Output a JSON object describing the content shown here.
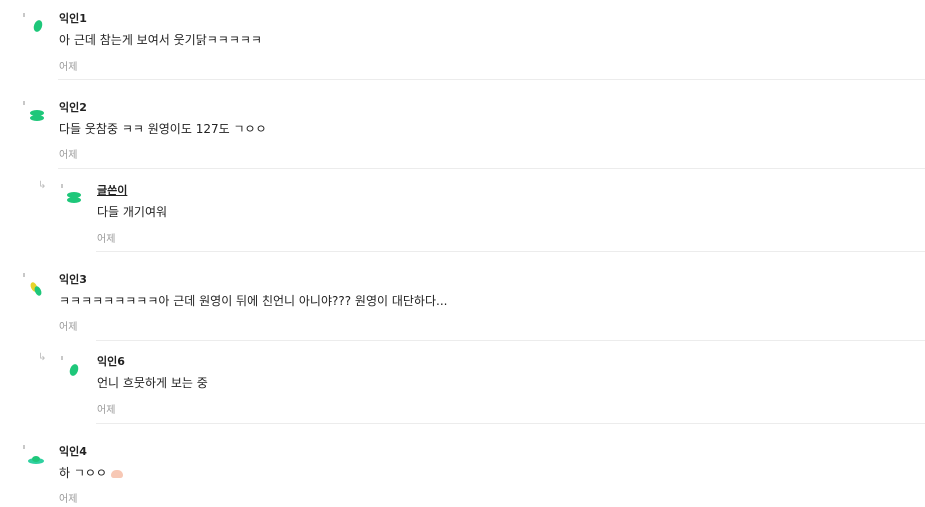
{
  "comments": [
    {
      "author": "익인1",
      "text": "아 근데 참는게 보여서 웃기닭ㅋㅋㅋㅋㅋ",
      "time": "어제"
    },
    {
      "author": "익인2",
      "text": "다들 웃참중 ㅋㅋ 원영이도 127도 ㄱㅇㅇ",
      "time": "어제"
    },
    {
      "author": "글쓴이",
      "text": "다들 개기여워",
      "time": "어제",
      "reply": true
    },
    {
      "author": "익인3",
      "text": "ㅋㅋㅋㅋㅋㅋㅋㅋㅋ아 근데 원영이 뒤에 친언니 아니야??? 원영이 대단하다...",
      "time": "어제"
    },
    {
      "author": "익인6",
      "text": "언니 흐뭇하게 보는 중",
      "time": "어제",
      "reply": true
    },
    {
      "author": "익인4",
      "text": "하 ㄱㅇㅇ",
      "time": "어제"
    }
  ],
  "icons": {
    "reply_arrow": "reply-arrow-icon",
    "emoji": "hands-emoji-icon"
  },
  "colors": {
    "accent_green": "#1ec77a",
    "accent_teal": "#2fd0a0",
    "accent_yellow": "#e6d42b",
    "text": "#222222",
    "muted": "#999999"
  }
}
